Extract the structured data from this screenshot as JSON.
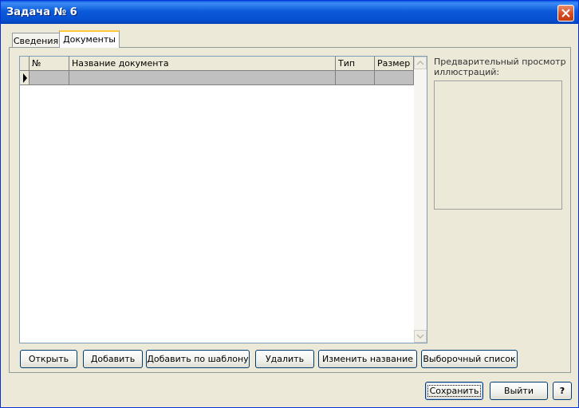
{
  "window": {
    "title": "Задача № 6"
  },
  "tabs": [
    {
      "label": "Сведения"
    },
    {
      "label": "Документы"
    }
  ],
  "grid": {
    "columns": [
      "№",
      "Название документа",
      "Тип",
      "Размер"
    ],
    "rows": [
      {
        "num": "",
        "name": "",
        "type": "",
        "size": ""
      }
    ]
  },
  "preview": {
    "label": "Предварительный просмотр иллюстраций:"
  },
  "actions": {
    "open": "Открыть",
    "add": "Добавить",
    "add_template": "Добавить по шаблону",
    "delete": "Удалить",
    "rename": "Изменить название",
    "select_list": "Выборочный список"
  },
  "footer": {
    "save": "Сохранить",
    "exit": "Выйти",
    "help": "?"
  }
}
